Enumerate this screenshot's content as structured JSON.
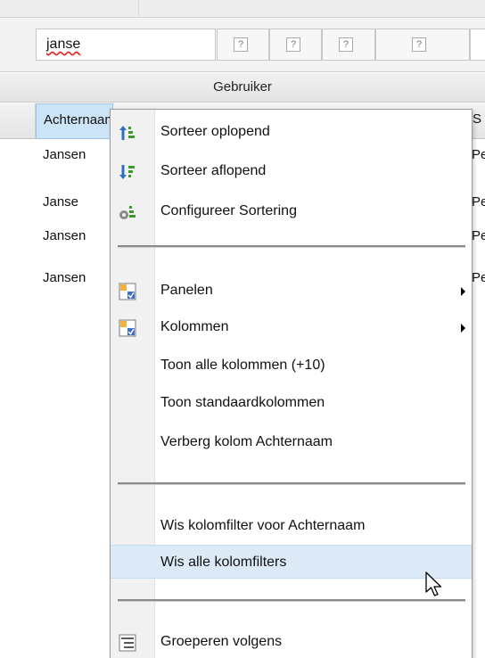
{
  "filter": {
    "value": "janse",
    "question_glyph": "?"
  },
  "group_header": {
    "label": "Gebruiker"
  },
  "columns": {
    "active_label": "Achternaam",
    "partial_right": "S"
  },
  "rows": [
    {
      "achternaam": "Jansen",
      "next": "Pe"
    },
    {
      "achternaam": "Janse",
      "next": "Pe"
    },
    {
      "achternaam": "Jansen",
      "next": "Pe"
    },
    {
      "achternaam": "Jansen",
      "next": "Pe"
    }
  ],
  "menu": {
    "sort_asc": "Sorteer oplopend",
    "sort_desc": "Sorteer aflopend",
    "configure_sort": "Configureer Sortering",
    "panels": "Panelen",
    "columns": "Kolommen",
    "show_all_columns": "Toon alle kolommen (+10)",
    "show_default_columns": "Toon standaardkolommen",
    "hide_column": "Verberg kolom Achternaam",
    "clear_column_filter": "Wis kolomfilter voor Achternaam",
    "clear_all_filters": "Wis alle kolomfilters",
    "group_by": "Groeperen volgens"
  },
  "colors": {
    "hover": "#dceaf8",
    "active_header": "#cde3f7",
    "sort_asc_green": "#3c9a2c",
    "sort_blue": "#2f6fc0"
  }
}
